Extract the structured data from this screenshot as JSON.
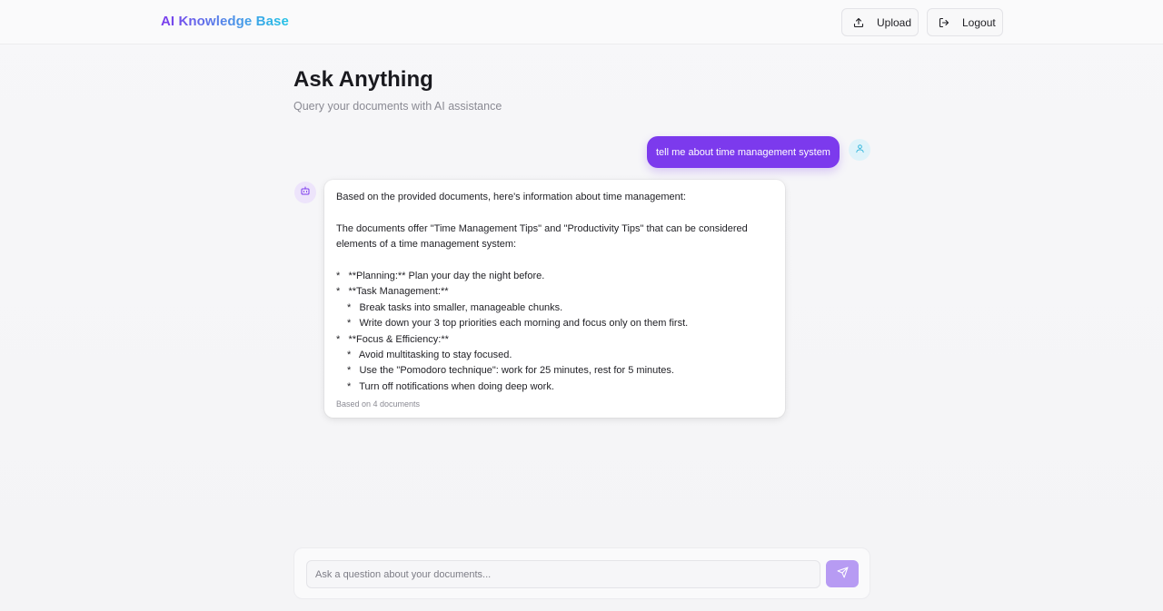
{
  "header": {
    "brand": "AI Knowledge Base",
    "upload_label": "Upload",
    "logout_label": "Logout"
  },
  "main": {
    "title": "Ask Anything",
    "subtitle": "Query your documents with AI assistance"
  },
  "conversation": {
    "user_message": "tell me about time management system",
    "assistant_lines": [
      "Based on the provided documents, here's information about time management:",
      "",
      "The documents offer \"Time Management Tips\" and \"Productivity Tips\" that can be considered",
      "elements of a time management system:",
      "",
      "*   **Planning:** Plan your day the night before.",
      "*   **Task Management:**",
      "*   Break tasks into smaller, manageable chunks.",
      "*   Write down your 3 top priorities each morning and focus only on them first.",
      "*   **Focus & Efficiency:**",
      "*   Avoid multitasking to stay focused.",
      "*   Use the \"Pomodoro technique\": work for 25 minutes, rest for 5 minutes.",
      "*   Turn off notifications when doing deep work."
    ],
    "source_note": "Based on 4 documents"
  },
  "composer": {
    "placeholder": "Ask a question about your documents...",
    "value": ""
  },
  "colors": {
    "accent": "#7c3aed",
    "send_button": "#b79bf3",
    "brand_gradient_start": "#7c3aed",
    "brand_gradient_end": "#22c3e6"
  },
  "icons": {
    "upload": "upload-icon",
    "logout": "logout-icon",
    "user_avatar": "user-icon",
    "bot_avatar": "bot-icon",
    "send": "send-icon"
  }
}
